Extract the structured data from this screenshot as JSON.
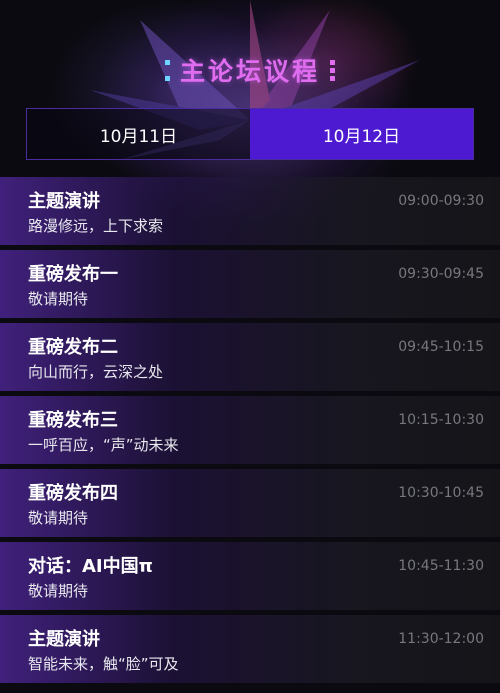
{
  "header": {
    "title": "主论坛议程",
    "accent_color": "#e06cf0",
    "deco_color_left": "#6fd4ff",
    "tab_active_color": "#4d1ad1"
  },
  "tabs": [
    {
      "label": "10月11日",
      "active": false
    },
    {
      "label": "10月12日",
      "active": true
    }
  ],
  "agenda": [
    {
      "title": "主题演讲",
      "subtitle": "路漫修远，上下求索",
      "time": "09:00-09:30"
    },
    {
      "title": "重磅发布一",
      "subtitle": "敬请期待",
      "time": "09:30-09:45"
    },
    {
      "title": "重磅发布二",
      "subtitle": "向山而行，云深之处",
      "time": "09:45-10:15"
    },
    {
      "title": "重磅发布三",
      "subtitle": "一呼百应，“声”动未来",
      "time": "10:15-10:30"
    },
    {
      "title": "重磅发布四",
      "subtitle": "敬请期待",
      "time": "10:30-10:45"
    },
    {
      "title": "对话：AI中国π",
      "subtitle": "敬请期待",
      "time": "10:45-11:30"
    },
    {
      "title": "主题演讲",
      "subtitle": "智能未来，触“脸”可及",
      "time": "11:30-12:00"
    }
  ]
}
